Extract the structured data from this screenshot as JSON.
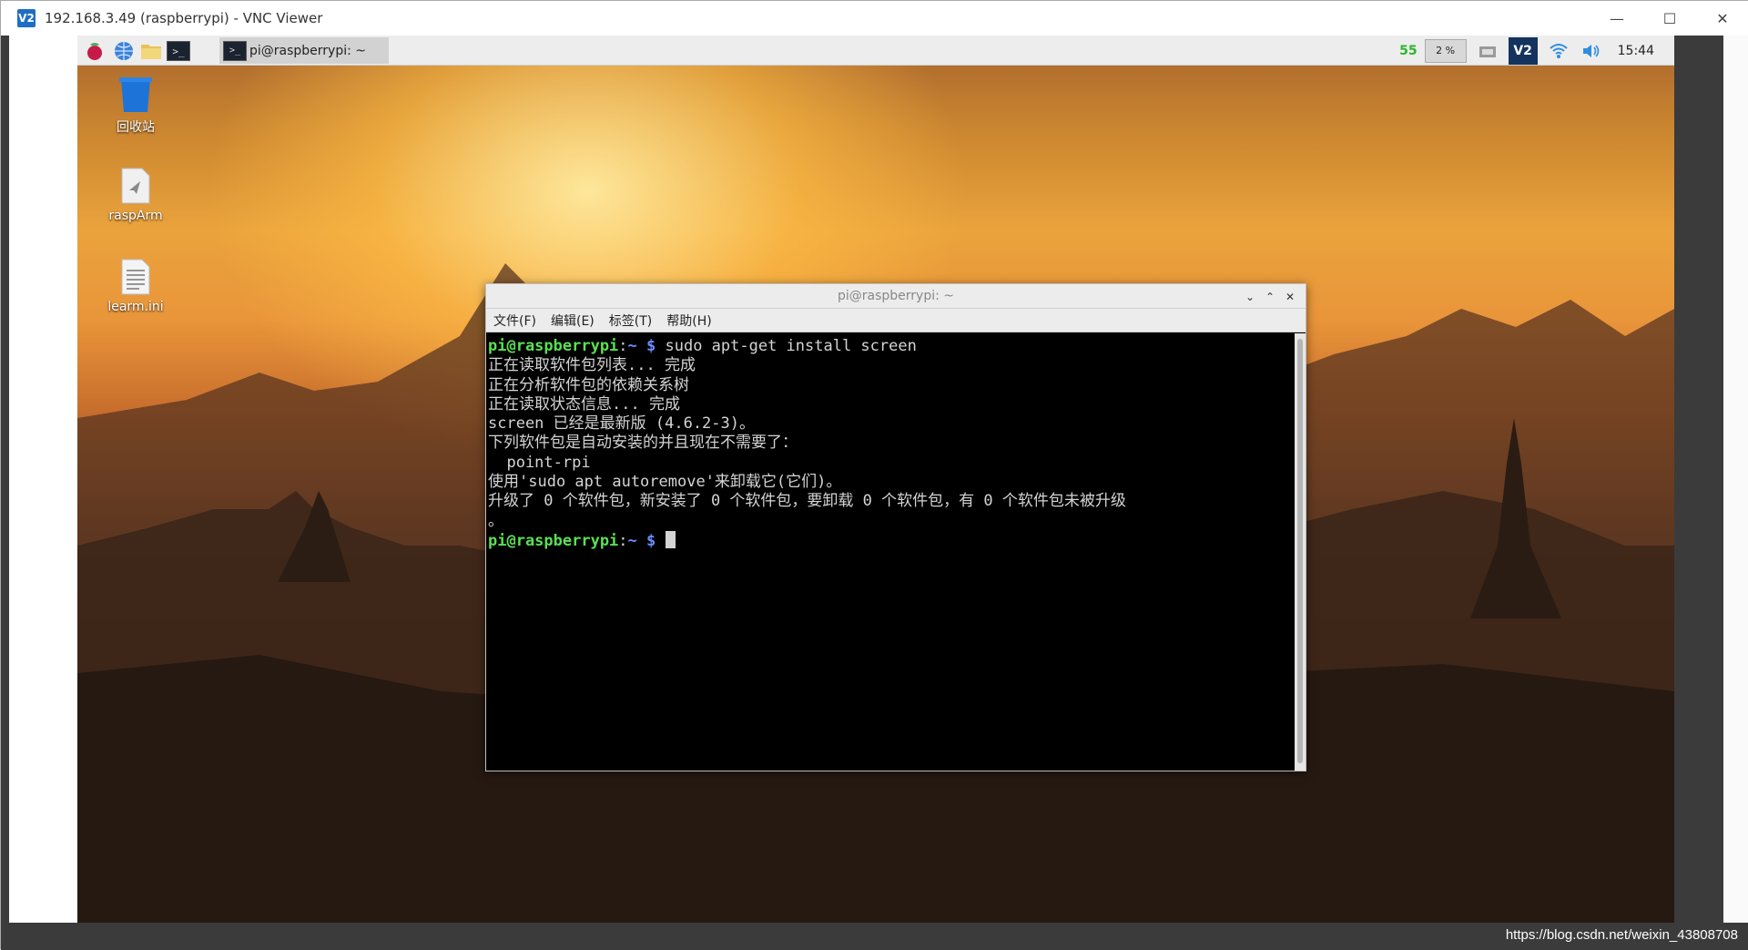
{
  "vnc": {
    "app_icon": "V2",
    "title": "192.168.3.49 (raspberrypi) - VNC Viewer",
    "controls": {
      "minimize": "—",
      "maximize": "☐",
      "close": "✕"
    },
    "watermark": "https://blog.csdn.net/weixin_43808708"
  },
  "panel": {
    "icons": [
      "raspberry-menu-icon",
      "web-browser-icon",
      "file-manager-icon",
      "terminal-icon"
    ],
    "terminal_glyph": ">_",
    "task": {
      "label": "pi@raspberrypi: ~",
      "icon_glyph": ">_"
    },
    "tray": {
      "num": "55",
      "cpu": "2 %",
      "vnc": "V2",
      "clock": "15:44"
    }
  },
  "desktop": {
    "icons": [
      {
        "label": "回收站",
        "icon": "trash-icon"
      },
      {
        "label": "raspArm",
        "icon": "document-icon"
      },
      {
        "label": "learm.ini",
        "icon": "text-file-icon"
      }
    ]
  },
  "terminal": {
    "title": "pi@raspberrypi: ~",
    "menus": [
      "文件(F)",
      "编辑(E)",
      "标签(T)",
      "帮助(H)"
    ],
    "controls": {
      "minimize": "⌄",
      "maximize": "⌃",
      "close": "✕"
    },
    "prompt_user": "pi@raspberrypi",
    "prompt_sep": ":",
    "prompt_path": "~ $",
    "command": " sudo apt-get install screen",
    "output": [
      "正在读取软件包列表... 完成",
      "正在分析软件包的依赖关系树",
      "正在读取状态信息... 完成",
      "screen 已经是最新版 (4.6.2-3)。",
      "下列软件包是自动安装的并且现在不需要了：",
      "  point-rpi",
      "使用'sudo apt autoremove'来卸载它(它们)。",
      "升级了 0 个软件包，新安装了 0 个软件包，要卸载 0 个软件包，有 0 个软件包未被升级",
      "。"
    ]
  }
}
